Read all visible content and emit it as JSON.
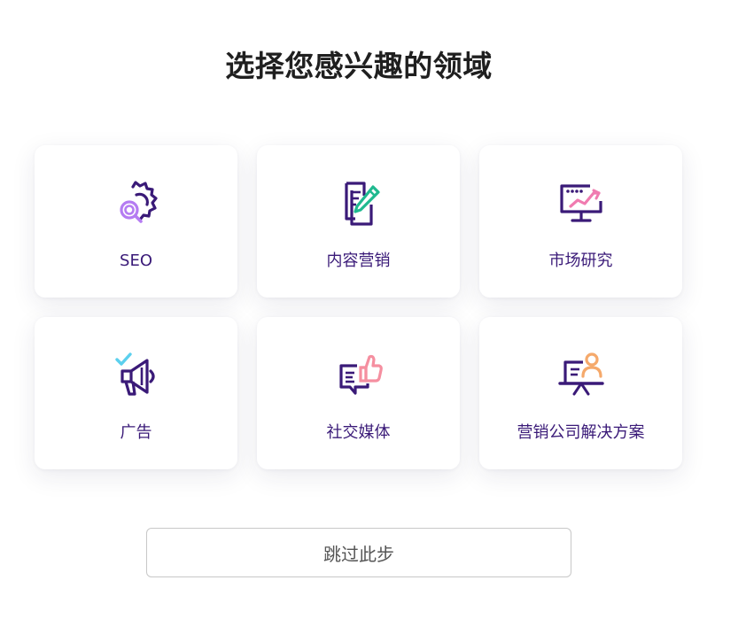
{
  "title": "选择您感兴趣的领域",
  "colors": {
    "primary": "#3a1a78",
    "purple_light": "#b57cf2",
    "green": "#1fb98f",
    "pink": "#f07bb0",
    "coral": "#f58fa0",
    "cyan": "#5bd0ee",
    "orange": "#f5a96b"
  },
  "categories": [
    {
      "label": "SEO",
      "icon": "gear-magnifier-icon"
    },
    {
      "label": "内容营销",
      "icon": "document-pencil-icon"
    },
    {
      "label": "市场研究",
      "icon": "monitor-chart-icon"
    },
    {
      "label": "广告",
      "icon": "megaphone-icon"
    },
    {
      "label": "社交媒体",
      "icon": "chat-thumbs-up-icon"
    },
    {
      "label": "营销公司解决方案",
      "icon": "presenter-board-icon"
    }
  ],
  "skip_label": "跳过此步"
}
